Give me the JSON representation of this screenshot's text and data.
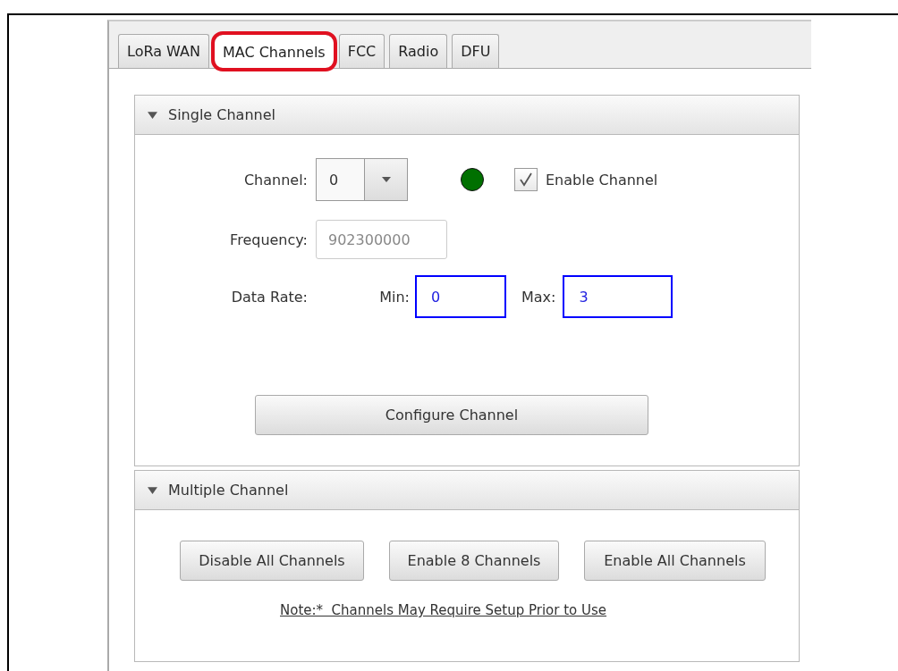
{
  "tabs": [
    {
      "label": "LoRa WAN",
      "selected": false,
      "highlighted": false
    },
    {
      "label": "MAC Channels",
      "selected": true,
      "highlighted": true
    },
    {
      "label": "FCC",
      "selected": false,
      "highlighted": false
    },
    {
      "label": "Radio",
      "selected": false,
      "highlighted": false
    },
    {
      "label": "DFU",
      "selected": false,
      "highlighted": false
    }
  ],
  "single_channel": {
    "title": "Single Channel",
    "expanded": true,
    "channel": {
      "label": "Channel:",
      "value": "0"
    },
    "status_dot": {
      "color": "#007000"
    },
    "enable_channel": {
      "label": "Enable Channel",
      "checked": true
    },
    "frequency": {
      "label": "Frequency:",
      "value": "902300000",
      "disabled": true
    },
    "data_rate": {
      "label": "Data Rate:",
      "min": {
        "label": "Min:",
        "value": "0"
      },
      "max": {
        "label": "Max:",
        "value": "3"
      }
    },
    "button": "Configure Channel"
  },
  "multiple_channel": {
    "title": "Multiple Channel",
    "expanded": true,
    "buttons": [
      "Disable All Channels",
      "Enable 8 Channels",
      "Enable All Channels"
    ],
    "note": "Note:*  Channels May Require Setup Prior to Use"
  }
}
